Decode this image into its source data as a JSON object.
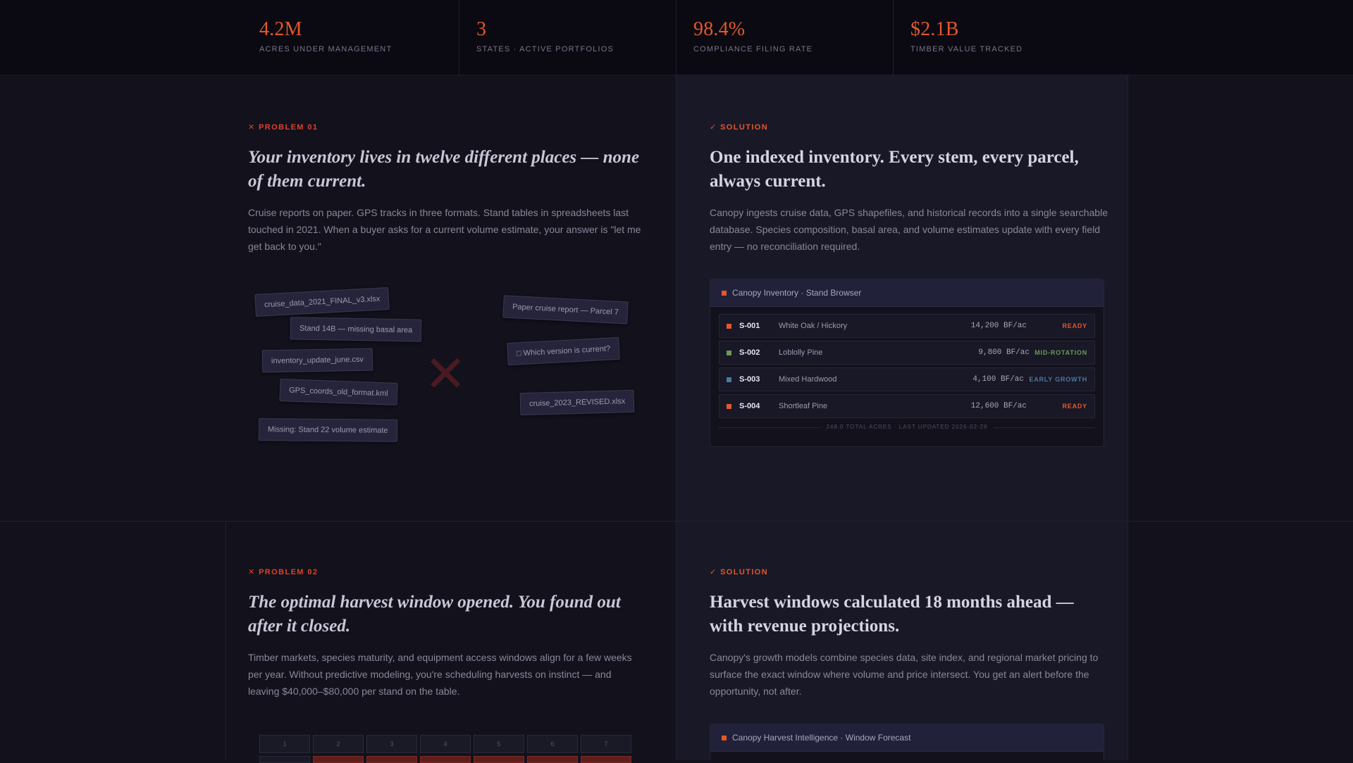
{
  "stats": [
    {
      "value": "4.2M",
      "label": "ACRES UNDER MANAGEMENT"
    },
    {
      "value": "3",
      "label": "STATES · ACTIVE PORTFOLIOS"
    },
    {
      "value": "98.4%",
      "label": "COMPLIANCE FILING RATE"
    },
    {
      "value": "$2.1B",
      "label": "TIMBER VALUE TRACKED"
    }
  ],
  "problem1": {
    "tag": "✕ PROBLEM 01",
    "heading": "Your inventory lives in twelve different places — none of them current.",
    "body": "Cruise reports on paper. GPS tracks in three formats. Stand tables in spreadsheets last touched in 2021. When a buyer asks for a current volume estimate, your answer is \"let me get back to you.\"",
    "chips": [
      "cruise_data_2021_FINAL_v3.xlsx",
      "Stand 14B — missing basal area",
      "inventory_update_june.csv",
      "GPS_coords_old_format.kml",
      "Missing: Stand 22 volume estimate",
      "Paper cruise report — Parcel 7",
      "□ Which version is current?",
      "cruise_2023_REVISED.xlsx"
    ],
    "x_icon": "✕"
  },
  "solution1": {
    "tag": "✓ SOLUTION",
    "heading": "One indexed inventory. Every stem, every parcel, always current.",
    "body": "Canopy ingests cruise data, GPS shapefiles, and historical records into a single searchable database. Species composition, basal area, and volume estimates update with every field entry — no reconciliation required.",
    "card_title": "Canopy Inventory · Stand Browser",
    "rows": [
      {
        "id": "S-001",
        "name": "White Oak / Hickory",
        "volume": "14,200 BF/ac",
        "status": "READY",
        "color": "#e2582c"
      },
      {
        "id": "S-002",
        "name": "Loblolly Pine",
        "volume": "9,800 BF/ac",
        "status": "MID-ROTATION",
        "color": "#6a9a58"
      },
      {
        "id": "S-003",
        "name": "Mixed Hardwood",
        "volume": "4,100 BF/ac",
        "status": "EARLY GROWTH",
        "color": "#4a7a9e"
      },
      {
        "id": "S-004",
        "name": "Shortleaf Pine",
        "volume": "12,600 BF/ac",
        "status": "READY",
        "color": "#e2582c"
      }
    ],
    "footer": "248.0 TOTAL ACRES · LAST UPDATED 2026-02-28"
  },
  "problem2": {
    "tag": "✕ PROBLEM 02",
    "heading": "The optimal harvest window opened. You found out after it closed.",
    "body": "Timber markets, species maturity, and equipment access windows align for a few weeks per year. Without predictive modeling, you're scheduling harvests on instinct — and leaving $40,000–$80,000 per stand on the table.",
    "calendar": [
      "1",
      "2",
      "3",
      "4",
      "5",
      "6",
      "7"
    ]
  },
  "solution2": {
    "tag": "✓ SOLUTION",
    "heading": "Harvest windows calculated 18 months ahead — with revenue projections.",
    "body": "Canopy's growth models combine species data, site index, and regional market pricing to surface the exact window where volume and price intersect. You get an alert before the opportunity, not after.",
    "card_title": "Canopy Harvest Intelligence · Window Forecast"
  },
  "colors": {
    "accent": "#e2582c",
    "problem": "#e0402a",
    "background": "#12111c",
    "solution_bg": "#191827"
  }
}
